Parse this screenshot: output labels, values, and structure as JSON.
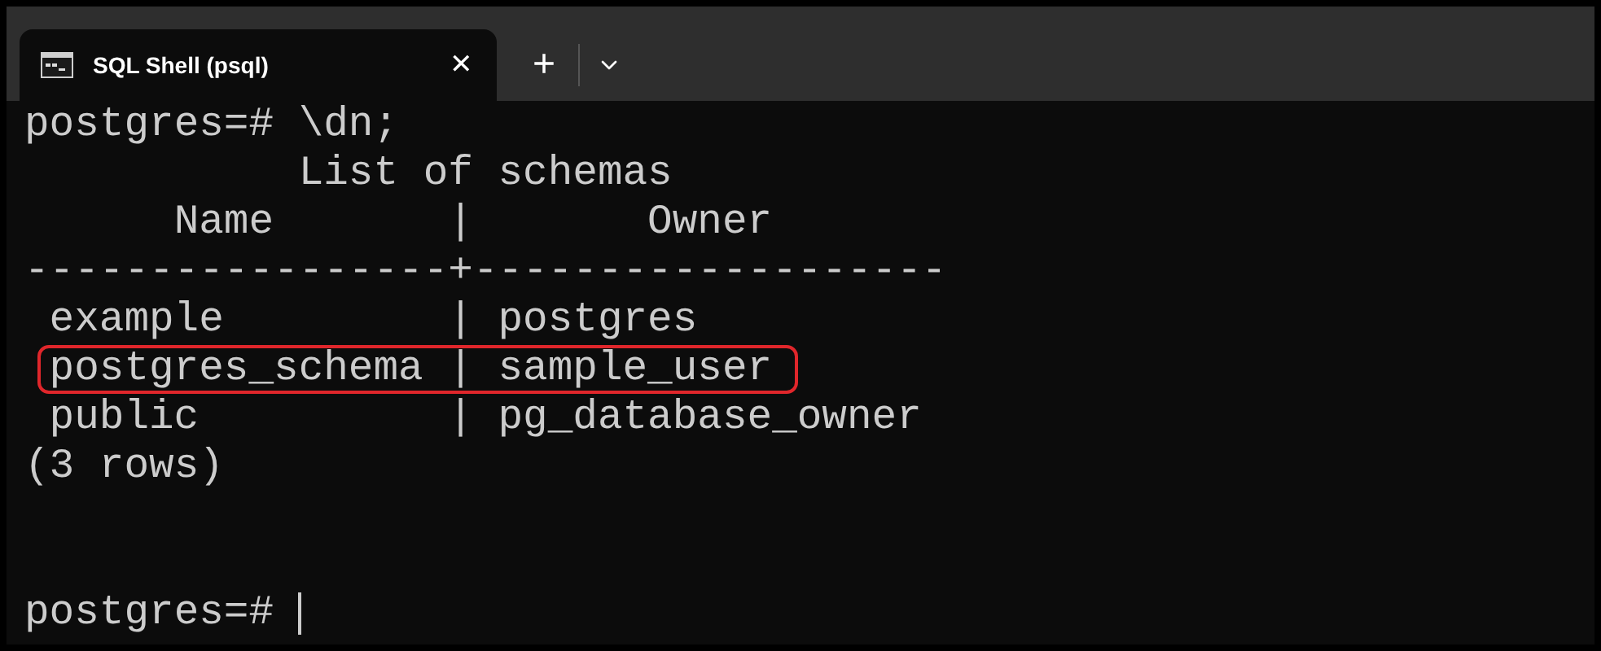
{
  "tabs": [
    {
      "title": "SQL Shell (psql)",
      "selected": true,
      "close": "✕"
    }
  ],
  "new_tab": "+",
  "terminal": {
    "command": "postgres=# \\dn;",
    "title": "           List of schemas",
    "header": "      Name       |       Owner",
    "separator": "-----------------+-------------------",
    "rows": [
      {
        "text": "example         | postgres",
        "highlighted": false
      },
      {
        "text": "postgres_schema | sample_user",
        "highlighted": true
      },
      {
        "text": "public          | pg_database_owner",
        "highlighted": false
      }
    ],
    "footer": "(3 rows)",
    "prompt": "postgres=#"
  }
}
